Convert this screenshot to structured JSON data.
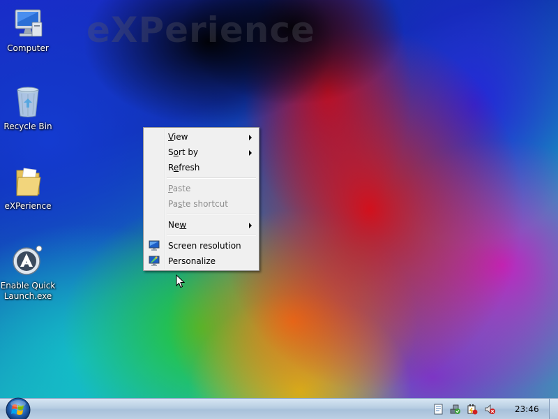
{
  "wallpaper": {
    "watermark": "eXPerience"
  },
  "desktop_icons": [
    {
      "label": "Computer",
      "icon": "computer-icon"
    },
    {
      "label": "Recycle Bin",
      "icon": "recycle-bin-icon"
    },
    {
      "label": "eXPerience",
      "icon": "folder-icon"
    },
    {
      "label": "Enable Quick Launch.exe",
      "icon": "application-icon"
    }
  ],
  "context_menu": {
    "items": [
      {
        "label": "View",
        "access_key": "V",
        "submenu": true,
        "enabled": true
      },
      {
        "label": "Sort by",
        "access_key": "o",
        "submenu": true,
        "enabled": true
      },
      {
        "label": "Refresh",
        "access_key": "e",
        "submenu": false,
        "enabled": true
      },
      {
        "label": "Paste",
        "access_key": "P",
        "submenu": false,
        "enabled": false
      },
      {
        "label": "Paste shortcut",
        "access_key": "s",
        "submenu": false,
        "enabled": false
      },
      {
        "label": "New",
        "access_key": "w",
        "submenu": true,
        "enabled": true
      },
      {
        "label": "Screen resolution",
        "access_key": "C",
        "submenu": false,
        "enabled": true,
        "icon": "display-icon"
      },
      {
        "label": "Personalize",
        "access_key": "R",
        "submenu": false,
        "enabled": true,
        "icon": "personalize-icon"
      }
    ]
  },
  "taskbar": {
    "start_icon": "windows-start-orb-icon",
    "tray_icons": [
      "action-center-icon",
      "network-icon",
      "power-icon",
      "volume-muted-icon"
    ],
    "clock": "23:46"
  },
  "colors": {
    "taskbar_top": "#d7e6f3",
    "taskbar_bottom": "#a8c1da",
    "menu_bg": "#f0f0f0",
    "menu_disabled_text": "#8d8d8d"
  }
}
